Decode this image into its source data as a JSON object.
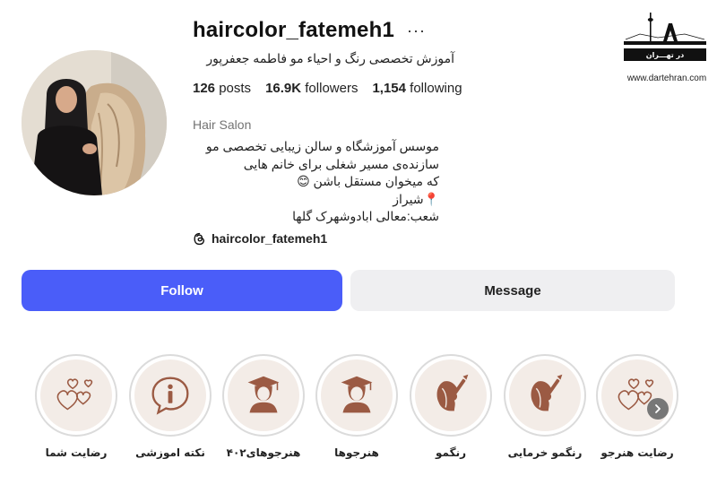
{
  "profile": {
    "username": "haircolor_fatemeh1",
    "more_label": "···",
    "subtitle": "آموزش تخصصی رنگ و احیاء مو فاطمه جعفرپور",
    "stats": {
      "posts": "126",
      "posts_label": "posts",
      "followers": "16.9K",
      "followers_label": "followers",
      "following": "1,154",
      "following_label": "following"
    },
    "category": "Hair Salon",
    "bio_lines": [
      "موسس آموزشگاه و سالن زیبایی تخصصی مو",
      "سازنده‌ی مسیر شغلی برای خانم هایی",
      "که میخوان مستقل باشن 😊",
      "📍شیراز",
      "شعب:معالی ابادوشهرک گلها"
    ],
    "threads_handle": "haircolor_fatemeh1"
  },
  "actions": {
    "follow_label": "Follow",
    "message_label": "Message"
  },
  "highlights": [
    {
      "label": "رضایت هنرجو",
      "icon": "hearts-icon"
    },
    {
      "label": "رنگمو خرمایی",
      "icon": "hair-color-icon"
    },
    {
      "label": "رنگمو",
      "icon": "hair-color-icon"
    },
    {
      "label": "هنرجوها",
      "icon": "graduate-icon"
    },
    {
      "label": "هنرجوهای۴۰۲",
      "icon": "graduate-icon"
    },
    {
      "label": "نکته اموزشی",
      "icon": "info-icon"
    },
    {
      "label": "رضایت شما",
      "icon": "hearts-icon"
    }
  ],
  "watermark": {
    "logo_text": "در تهـــران",
    "url": "www.dartehran.com"
  },
  "colors": {
    "follow_button": "#4a5df9",
    "message_button": "#efeff1",
    "highlight_icon": "#9b5a43",
    "highlight_bg": "#f3ece7"
  }
}
